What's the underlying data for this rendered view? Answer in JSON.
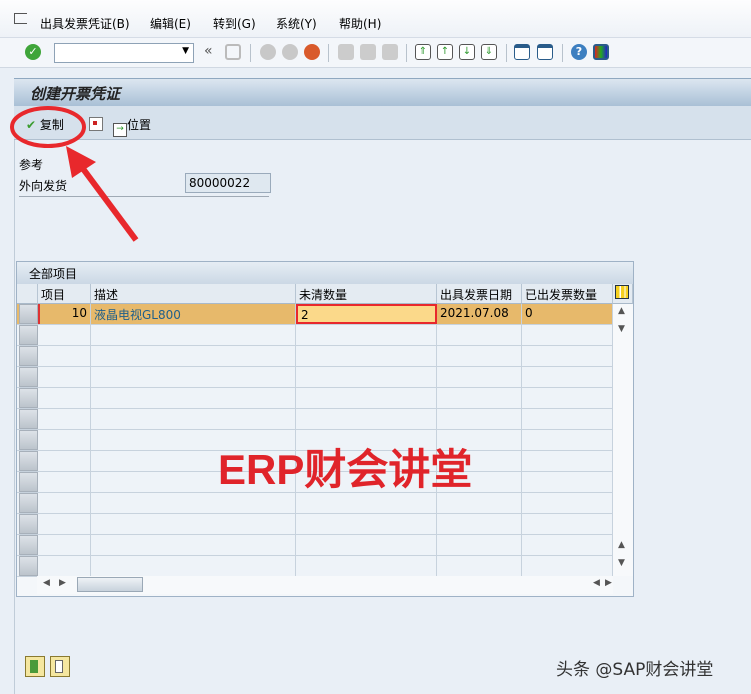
{
  "menu": [
    "出具发票凭证(B)",
    "编辑(E)",
    "转到(G)",
    "系统(Y)",
    "帮助(H)"
  ],
  "toolbar": {
    "command_value": "",
    "icons": [
      "enter-icon",
      "save-icon",
      "back-icon",
      "exit-icon",
      "cancel-icon",
      "print-icon",
      "find-icon",
      "find-next-icon",
      "first-page-icon",
      "prev-page-icon",
      "next-page-icon",
      "last-page-icon",
      "new-session-icon",
      "shortcut-icon",
      "help-icon",
      "customize-icon"
    ]
  },
  "title": "创建开票凭证",
  "appbar": {
    "copy": "复制",
    "position": "位置"
  },
  "reference": {
    "section": "参考",
    "field_label": "外向发货",
    "field_value": "80000022"
  },
  "table": {
    "title": "全部项目",
    "columns": [
      "项目",
      "描述",
      "未清数量",
      "出具发票日期",
      "已出发票数量"
    ],
    "rows": [
      {
        "item": "10",
        "desc": "液晶电视GL800",
        "open_qty": "2",
        "date": "2021.07.08",
        "invoiced": "0"
      }
    ]
  },
  "watermark": "ERP财会讲堂",
  "footer_watermark": "头条 @SAP财会讲堂",
  "colors": {
    "selected_row": "#e7b96b",
    "highlight": "#fbd98a",
    "annotation": "#e8282c"
  }
}
